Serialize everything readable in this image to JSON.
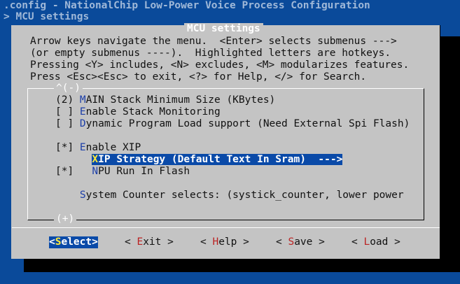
{
  "header": {
    "config_line": ".config - NationalChip Low-Power Voice Process Configuration",
    "breadcrumb": "> MCU settings"
  },
  "dialog": {
    "title": "MCU settings",
    "help_lines": [
      "Arrow keys navigate the menu.  <Enter> selects submenus --->",
      "(or empty submenus ----).  Highlighted letters are hotkeys.",
      "Pressing <Y> includes, <N> excludes, <M> modularizes features.",
      "Press <Esc><Esc> to exit, <?> for Help, </> for Search."
    ],
    "scroll_up": "^(-)",
    "scroll_down": "(+)",
    "items": [
      {
        "prefix": "(2) ",
        "hotkey": "M",
        "rest": "AIN Stack Minimum Size (KBytes)"
      },
      {
        "prefix": "[ ] ",
        "hotkey": "E",
        "rest": "nable Stack Monitoring"
      },
      {
        "prefix": "[ ] ",
        "hotkey": "D",
        "rest": "ynamic Program Load support (Need External Spi Flash)"
      },
      {
        "prefix": "[*] ",
        "hotkey": "E",
        "rest": "nable XIP"
      },
      {
        "prefix": "      ",
        "hotkey": "X",
        "rest": "IP Strategy (Default Text In Sram)  --->",
        "selected": true
      },
      {
        "prefix": "[*]   ",
        "hotkey": "N",
        "rest": "PU Run In Flash"
      },
      {
        "prefix": "    ",
        "hotkey": "S",
        "rest": "ystem Counter selects: (systick_counter, lower power"
      }
    ]
  },
  "buttons": [
    {
      "open": "<",
      "hotkey": "S",
      "rest": "elect",
      "close": ">",
      "active": true
    },
    {
      "open": "< ",
      "hotkey": "E",
      "rest": "xit",
      "close": " >"
    },
    {
      "open": "< ",
      "hotkey": "H",
      "rest": "elp",
      "close": " >"
    },
    {
      "open": "< ",
      "hotkey": "S",
      "rest": "ave",
      "close": " >"
    },
    {
      "open": "< ",
      "hotkey": "L",
      "rest": "oad",
      "close": " >"
    }
  ]
}
